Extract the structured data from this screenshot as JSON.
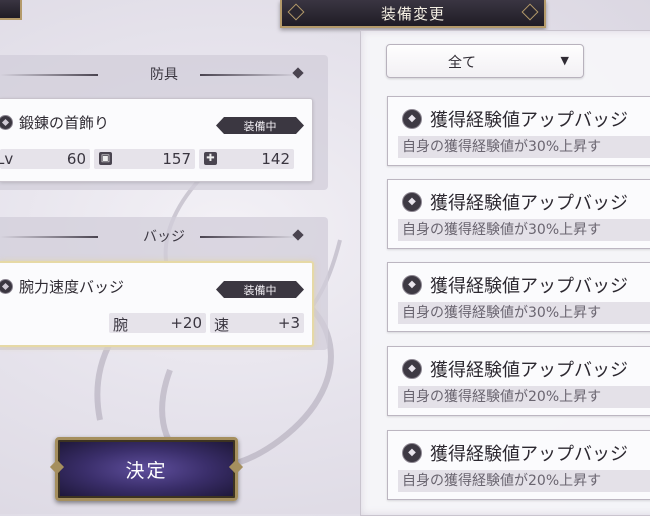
{
  "header": {
    "title": "装備変更"
  },
  "left": {
    "armor_section": {
      "title": "防具",
      "item": {
        "name": "鍛錬の首飾り",
        "status": "装備中",
        "stats": [
          {
            "label": "Lv",
            "value": "60"
          },
          {
            "icon": "shield-icon",
            "value": "157"
          },
          {
            "icon": "cross-shield-icon",
            "value": "142"
          }
        ]
      }
    },
    "badge_section": {
      "title": "バッジ",
      "item": {
        "name": "腕力速度バッジ",
        "status": "装備中",
        "stats": [
          {
            "label": "腕",
            "value": "+20"
          },
          {
            "label": "速",
            "value": "+3"
          }
        ]
      }
    },
    "confirm_button": "決定"
  },
  "right": {
    "filter": {
      "selected": "全て"
    },
    "items": [
      {
        "name": "獲得経験値アップバッジ",
        "desc": "自身の獲得経験値が30%上昇す"
      },
      {
        "name": "獲得経験値アップバッジ",
        "desc": "自身の獲得経験値が30%上昇す"
      },
      {
        "name": "獲得経験値アップバッジ",
        "desc": "自身の獲得経験値が30%上昇す"
      },
      {
        "name": "獲得経験値アップバッジ",
        "desc": "自身の獲得経験値が20%上昇す"
      },
      {
        "name": "獲得経験値アップバッジ",
        "desc": "自身の獲得経験値が20%上昇す"
      }
    ]
  },
  "colors": {
    "accent_gold": "#b49a6a",
    "button_purple": "#3a2e6a",
    "plate_dark": "#2a2630"
  }
}
